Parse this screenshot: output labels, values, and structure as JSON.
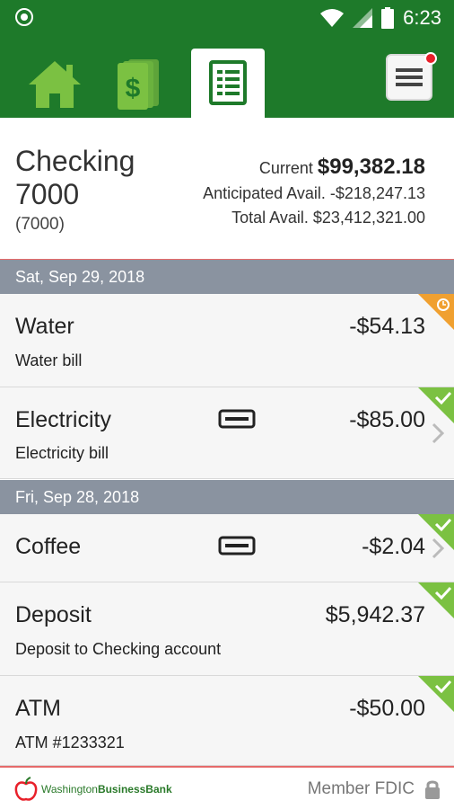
{
  "status_bar": {
    "time": "6:23"
  },
  "nav": {
    "tabs": [
      {
        "icon": "home-icon"
      },
      {
        "icon": "money-icon"
      },
      {
        "icon": "ledger-icon",
        "active": true
      }
    ],
    "menu_icon": "hamburger-menu-icon",
    "badge_color": "#e8202a"
  },
  "account": {
    "name_line1": "Checking",
    "name_line2": "7000",
    "number": "(7000)",
    "current_label": "Current",
    "current_value": "$99,382.18",
    "anticipated_label": "Anticipated Avail.",
    "anticipated_value": "-$218,247.13",
    "total_label": "Total Avail.",
    "total_value": "$23,412,321.00"
  },
  "groups": [
    {
      "date": "Sat, Sep 29, 2018",
      "transactions": [
        {
          "title": "Water",
          "description": "Water bill",
          "amount": "-$54.13",
          "status": "pending"
        },
        {
          "title": "Electricity",
          "description": "Electricity bill",
          "amount": "-$85.00",
          "status": "cleared",
          "card": true,
          "chevron": true
        }
      ]
    },
    {
      "date": "Fri, Sep 28, 2018",
      "transactions": [
        {
          "title": "Coffee",
          "description": "",
          "amount": "-$2.04",
          "status": "cleared",
          "card": true,
          "chevron": true
        },
        {
          "title": "Deposit",
          "description": "Deposit to Checking account",
          "amount": "$5,942.37",
          "status": "cleared"
        },
        {
          "title": "ATM",
          "description": "ATM #1233321",
          "amount": "-$50.00",
          "status": "cleared"
        }
      ]
    }
  ],
  "footer": {
    "logo_part1": "Washington",
    "logo_part2": "BusinessBank",
    "member_text": "Member FDIC"
  },
  "colors": {
    "brand_green": "#1e7a2a",
    "pending_orange": "#f0a030",
    "cleared_green": "#7bc142"
  }
}
